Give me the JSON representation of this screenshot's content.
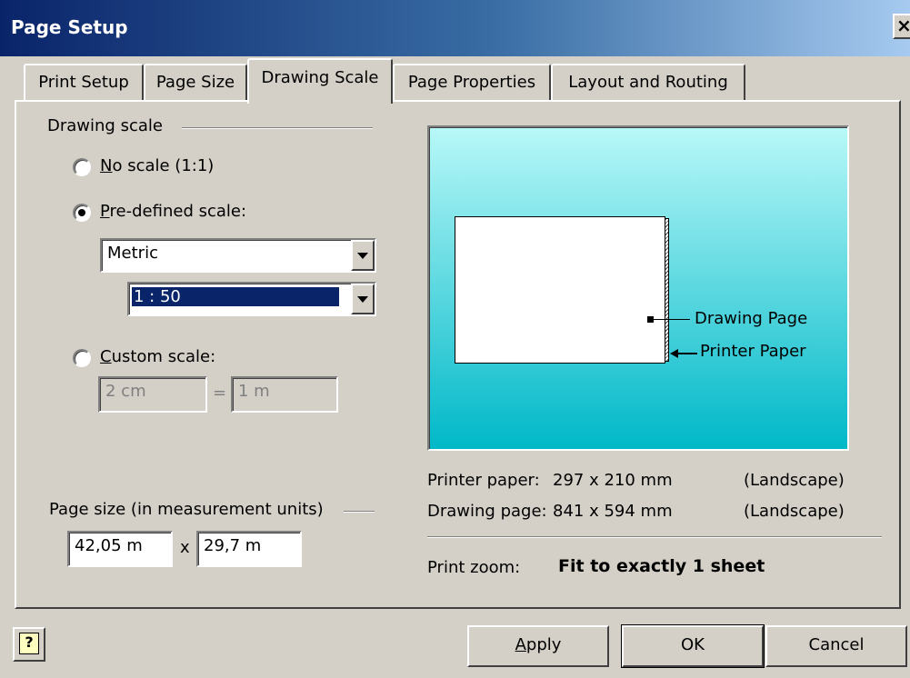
{
  "window": {
    "title": "Page Setup",
    "close_glyph": "×"
  },
  "tabs": [
    {
      "label": "Print Setup"
    },
    {
      "label": "Page Size"
    },
    {
      "label": "Drawing Scale",
      "active": true
    },
    {
      "label": "Page Properties"
    },
    {
      "label": "Layout and Routing"
    }
  ],
  "drawing_scale": {
    "group_label": "Drawing scale",
    "no_scale": {
      "mnemonic": "N",
      "rest": "o scale (1:1)",
      "selected": false
    },
    "predefined": {
      "mnemonic": "P",
      "rest": "re-defined scale:",
      "selected": true
    },
    "predefined_system": "Metric",
    "predefined_ratio": "1 : 50",
    "custom": {
      "mnemonic": "C",
      "rest": "ustom scale:",
      "selected": false
    },
    "custom_page_value": "2 cm",
    "equals": "=",
    "custom_real_value": "1 m"
  },
  "page_size": {
    "group_label": "Page size (in measurement units)",
    "width": "42,05 m",
    "times": "x",
    "height": "29,7 m"
  },
  "preview": {
    "drawing_page_label": "Drawing Page",
    "printer_paper_label": "Printer Paper",
    "gradient_top": "#b8f8f8",
    "gradient_bottom": "#00b8c8"
  },
  "info": {
    "printer_paper_label": "Printer paper:",
    "printer_paper_size": "297 x 210 mm",
    "printer_paper_orientation": "(Landscape)",
    "drawing_page_label": "Drawing page:",
    "drawing_page_size": "841 x 594 mm",
    "drawing_page_orientation": "(Landscape)",
    "print_zoom_label": "Print zoom:",
    "print_zoom_value": "Fit to exactly 1 sheet"
  },
  "buttons": {
    "help_glyph": "?",
    "apply_mnemonic": "A",
    "apply_rest": "pply",
    "ok": "OK",
    "cancel": "Cancel"
  },
  "colors": {
    "dialog_bg": "#d4d0c8",
    "titlebar_start": "#0a246a",
    "selection": "#0a246a"
  }
}
